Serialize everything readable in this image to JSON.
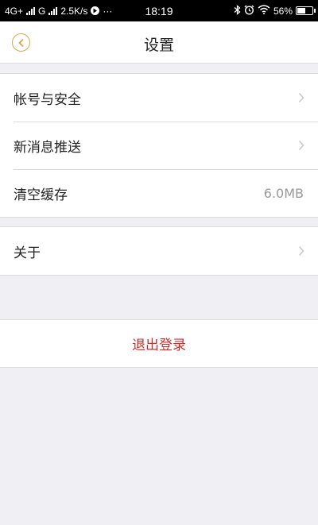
{
  "status_bar": {
    "network_1": "4G+",
    "network_2": "G",
    "speed": "2.5K/s",
    "more": "···",
    "time": "18:19",
    "battery": "56%",
    "battery_level": 0.56,
    "icons": [
      "signal-icon",
      "play-icon",
      "bluetooth-icon",
      "alarm-icon",
      "wifi-icon",
      "battery-icon"
    ]
  },
  "nav": {
    "title": "设置",
    "back_icon": "back-arrow-icon",
    "accent_color": "#e0a24a"
  },
  "settings": {
    "group1": [
      {
        "label": "帐号与安全",
        "chevron": true
      },
      {
        "label": "新消息推送",
        "chevron": true
      },
      {
        "label": "清空缓存",
        "value": "6.0MB"
      }
    ],
    "group2": [
      {
        "label": "关于",
        "chevron": true
      }
    ]
  },
  "logout": {
    "label": "退出登录",
    "color": "#c9302c"
  }
}
